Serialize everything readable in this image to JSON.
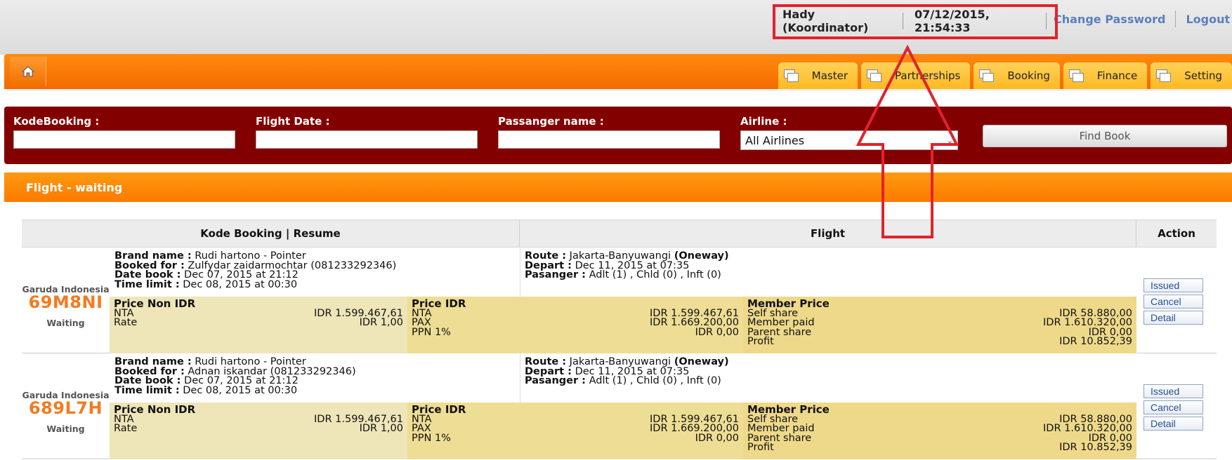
{
  "header": {
    "user_name": "Hady (Koordinator)",
    "datetime": "07/12/2015, 21:54:33",
    "change_password": "Change Password",
    "logout": "Logout"
  },
  "nav": {
    "home_icon": "home-icon",
    "tabs": [
      {
        "label": "Master",
        "icon": "window-icon"
      },
      {
        "label": "Partnerships",
        "icon": "window-icon"
      },
      {
        "label": "Booking",
        "icon": "window-icon"
      },
      {
        "label": "Finance",
        "icon": "window-icon"
      },
      {
        "label": "Setting",
        "icon": "window-icon"
      }
    ]
  },
  "search": {
    "kode_label": "KodeBooking :",
    "kode_value": "",
    "date_label": "Flight Date :",
    "date_value": "",
    "passenger_label": "Passanger name :",
    "passenger_value": "",
    "airline_label": "Airline :",
    "airline_value": "All Airlines",
    "find_button": "Find Book"
  },
  "section_title": "Flight - waiting",
  "table": {
    "headers": [
      "Kode Booking | Resume",
      "Flight",
      "Action"
    ],
    "rows": [
      {
        "airline": "Garuda Indonesia",
        "code": "69M8NI",
        "status": "Waiting",
        "brand_label": "Brand name :",
        "brand": "Rudi hartono - Pointer",
        "booked_label": "Booked for :",
        "booked": "Zulfydar zaidarmochtar (081233292346)",
        "datebook_label": "Date book :",
        "datebook": "Dec 07, 2015 at 21:12",
        "timelimit_label": "Time limit :",
        "timelimit": "Dec 08, 2015 at 00:30",
        "route_label": "Route :",
        "route": "Jakarta-Banyuwangi",
        "route_type": "(Oneway)",
        "depart_label": "Depart :",
        "depart": "Dec 11, 2015 at 07:35",
        "pax_label": "Pasanger :",
        "pax": "Adlt (1) , Chld (0) , Inft (0)",
        "non_idr": {
          "title": "Price Non IDR",
          "nta_label": "NTA",
          "nta": "IDR 1.599.467,61",
          "rate_label": "Rate",
          "rate": "IDR 1,00"
        },
        "idr": {
          "title": "Price IDR",
          "nta_label": "NTA",
          "nta": "IDR 1.599.467,61",
          "pax_label": "PAX",
          "pax": "IDR 1.669.200,00",
          "ppn_label": "PPN 1%",
          "ppn": "IDR 0,00"
        },
        "member": {
          "title": "Member Price",
          "self_label": "Self share",
          "self": "IDR 58.880,00",
          "paid_label": "Member paid",
          "paid": "IDR 1.610.320,00",
          "parent_label": "Parent share",
          "parent": "IDR 0,00",
          "profit_label": "Profit",
          "profit": "IDR 10.852,39"
        },
        "actions": [
          "Issued",
          "Cancel",
          "Detail"
        ]
      },
      {
        "airline": "Garuda Indonesia",
        "code": "689L7H",
        "status": "Waiting",
        "brand_label": "Brand name :",
        "brand": "Rudi hartono - Pointer",
        "booked_label": "Booked for :",
        "booked": "Adnan iskandar (081233292346)",
        "datebook_label": "Date book :",
        "datebook": "Dec 07, 2015 at 21:12",
        "timelimit_label": "Time limit :",
        "timelimit": "Dec 08, 2015 at 00:30",
        "route_label": "Route :",
        "route": "Jakarta-Banyuwangi",
        "route_type": "(Oneway)",
        "depart_label": "Depart :",
        "depart": "Dec 11, 2015 at 07:35",
        "pax_label": "Pasanger :",
        "pax": "Adlt (1) , Chld (0) , Inft (0)",
        "non_idr": {
          "title": "Price Non IDR",
          "nta_label": "NTA",
          "nta": "IDR 1.599.467,61",
          "rate_label": "Rate",
          "rate": "IDR 1,00"
        },
        "idr": {
          "title": "Price IDR",
          "nta_label": "NTA",
          "nta": "IDR 1.599.467,61",
          "pax_label": "PAX",
          "pax": "IDR 1.669.200,00",
          "ppn_label": "PPN 1%",
          "ppn": "IDR 0,00"
        },
        "member": {
          "title": "Member Price",
          "self_label": "Self share",
          "self": "IDR 58.880,00",
          "paid_label": "Member paid",
          "paid": "IDR 1.610.320,00",
          "parent_label": "Parent share",
          "parent": "IDR 0,00",
          "profit_label": "Profit",
          "profit": "IDR 10.852,39"
        },
        "actions": [
          "Issued",
          "Cancel",
          "Detail"
        ]
      }
    ]
  },
  "colors": {
    "nav_orange": "#f36a00",
    "search_bg": "#830000",
    "code_orange": "#f47b20",
    "annotation_red": "#e0232e"
  }
}
